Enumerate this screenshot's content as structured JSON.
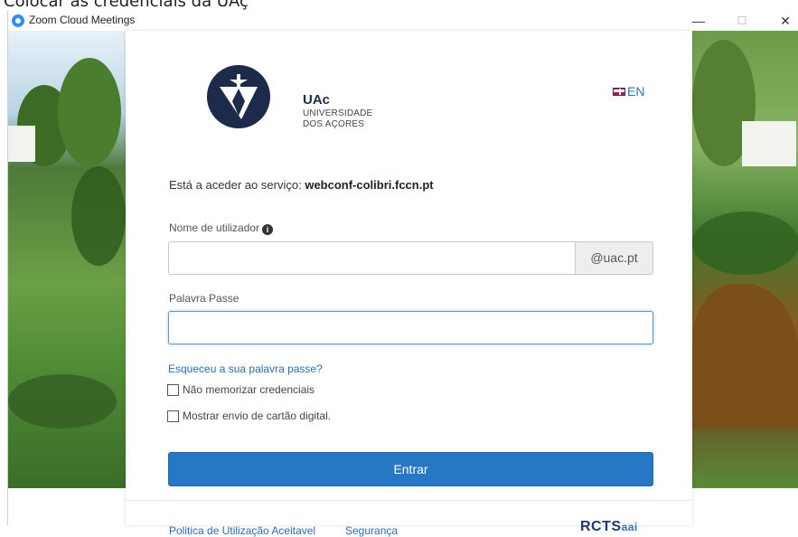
{
  "outer_caption": "Colocar as credenciais da UAç",
  "window": {
    "title": "Zoom Cloud Meetings",
    "minimize_label": "—",
    "maximize_label": "☐",
    "close_label": "✕"
  },
  "brand": {
    "name": "UAc",
    "line1": "UNIVERSIDADE",
    "line2": "DOS AÇORES",
    "color": "#1d2a4a"
  },
  "language": {
    "label": "EN"
  },
  "service": {
    "prefix": "Está a aceder ao serviço:",
    "host": "webconf-colibri.fccn.pt"
  },
  "form": {
    "username_label": "Nome de utilizador",
    "username_value": "",
    "username_domain": "@uac.pt",
    "password_label": "Palavra Passe",
    "password_value": "",
    "forgot_link": "Esqueceu a sua palavra passe?",
    "checkbox_no_remember": "Não memorizar credenciais",
    "checkbox_show_card": "Mostrar envio de cartão digital.",
    "submit_label": "Entrar",
    "accent_color": "#2677c4"
  },
  "footer": {
    "policy_link": "Politica de Utilização Aceitavel",
    "security_link": "Segurança",
    "rcts_main": "RCTS",
    "rcts_sub": "aai"
  }
}
